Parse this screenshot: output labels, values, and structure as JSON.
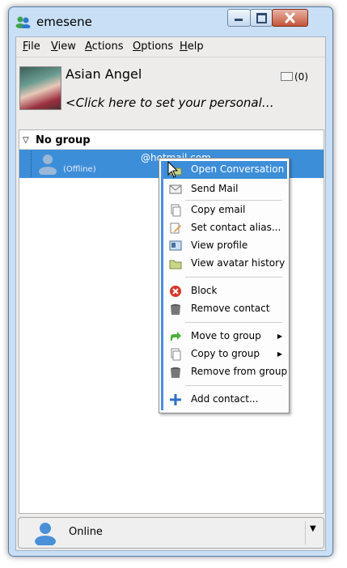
{
  "window": {
    "title": "emesene"
  },
  "menu": [
    {
      "accel": "F",
      "rest": "ile"
    },
    {
      "accel": "V",
      "rest": "iew"
    },
    {
      "accel": "A",
      "rest": "ctions"
    },
    {
      "accel": "O",
      "rest": "ptions"
    },
    {
      "accel": "H",
      "rest": "elp"
    }
  ],
  "profile": {
    "nick": "Asian Angel",
    "personal_message": "<Click here to set your personal…",
    "mail_count": "(0)"
  },
  "group": {
    "name": "No group"
  },
  "contact": {
    "email": "@hotmail.com",
    "status": "(Offline)"
  },
  "context_menu": {
    "items": [
      {
        "label": "Open Conversation",
        "icon": "folder-open-icon"
      },
      {
        "label": "Send Mail",
        "icon": "mail-icon"
      },
      {
        "label": "Copy email",
        "icon": "copy-icon"
      },
      {
        "label": "Set contact alias...",
        "icon": "pencil-icon"
      },
      {
        "label": "View profile",
        "icon": "profile-icon"
      },
      {
        "label": "View avatar history",
        "icon": "folder-icon"
      },
      {
        "label": "Block",
        "icon": "block-icon"
      },
      {
        "label": "Remove contact",
        "icon": "trash-icon"
      },
      {
        "label": "Move to group",
        "icon": "move-arrow-icon"
      },
      {
        "label": "Copy to group",
        "icon": "copy-icon"
      },
      {
        "label": "Remove from group",
        "icon": "trash-icon"
      },
      {
        "label": "Add contact...",
        "icon": "plus-icon"
      }
    ]
  },
  "status": {
    "label": "Online"
  },
  "colors": {
    "selection": "#3d8ed9",
    "window_frame": "#c9dff5"
  }
}
